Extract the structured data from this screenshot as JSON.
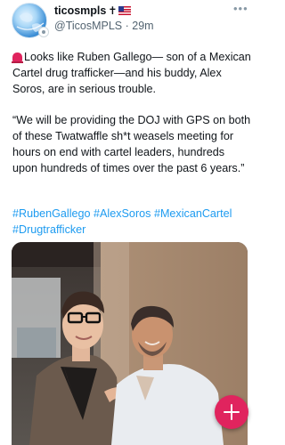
{
  "post": {
    "author": {
      "display_name": "ticosmpls",
      "display_name_emoji": "✝",
      "flag_icon": "us-flag-icon",
      "handle": "@TicosMPLS",
      "separator": "·",
      "time_ago": "29m"
    },
    "more_icon": "more-horizontal-icon",
    "paragraph_1": {
      "emoji_icon": "police-light-icon",
      "text": "Looks like Ruben Gallego— son of a Mexican Cartel drug trafficker—and his buddy, Alex Soros, are in serious trouble."
    },
    "paragraph_2": "“We will be providing the DOJ with GPS on both of these Twatwaffle sh*t weasels meeting for hours on end with cartel leaders, hundreds upon hundreds of times over the past 6 years.”",
    "hashtags": [
      "#RubenGallego",
      "#AlexSoros",
      "#MexicanCartel",
      "#Drugtrafficker"
    ],
    "photo": {
      "type": "photo-two-men"
    }
  },
  "fab": {
    "icon": "plus-icon",
    "color": "#e0245e"
  },
  "colors": {
    "link": "#1d9bf0",
    "secondary_text": "#536471",
    "primary_text": "#0f1419"
  }
}
